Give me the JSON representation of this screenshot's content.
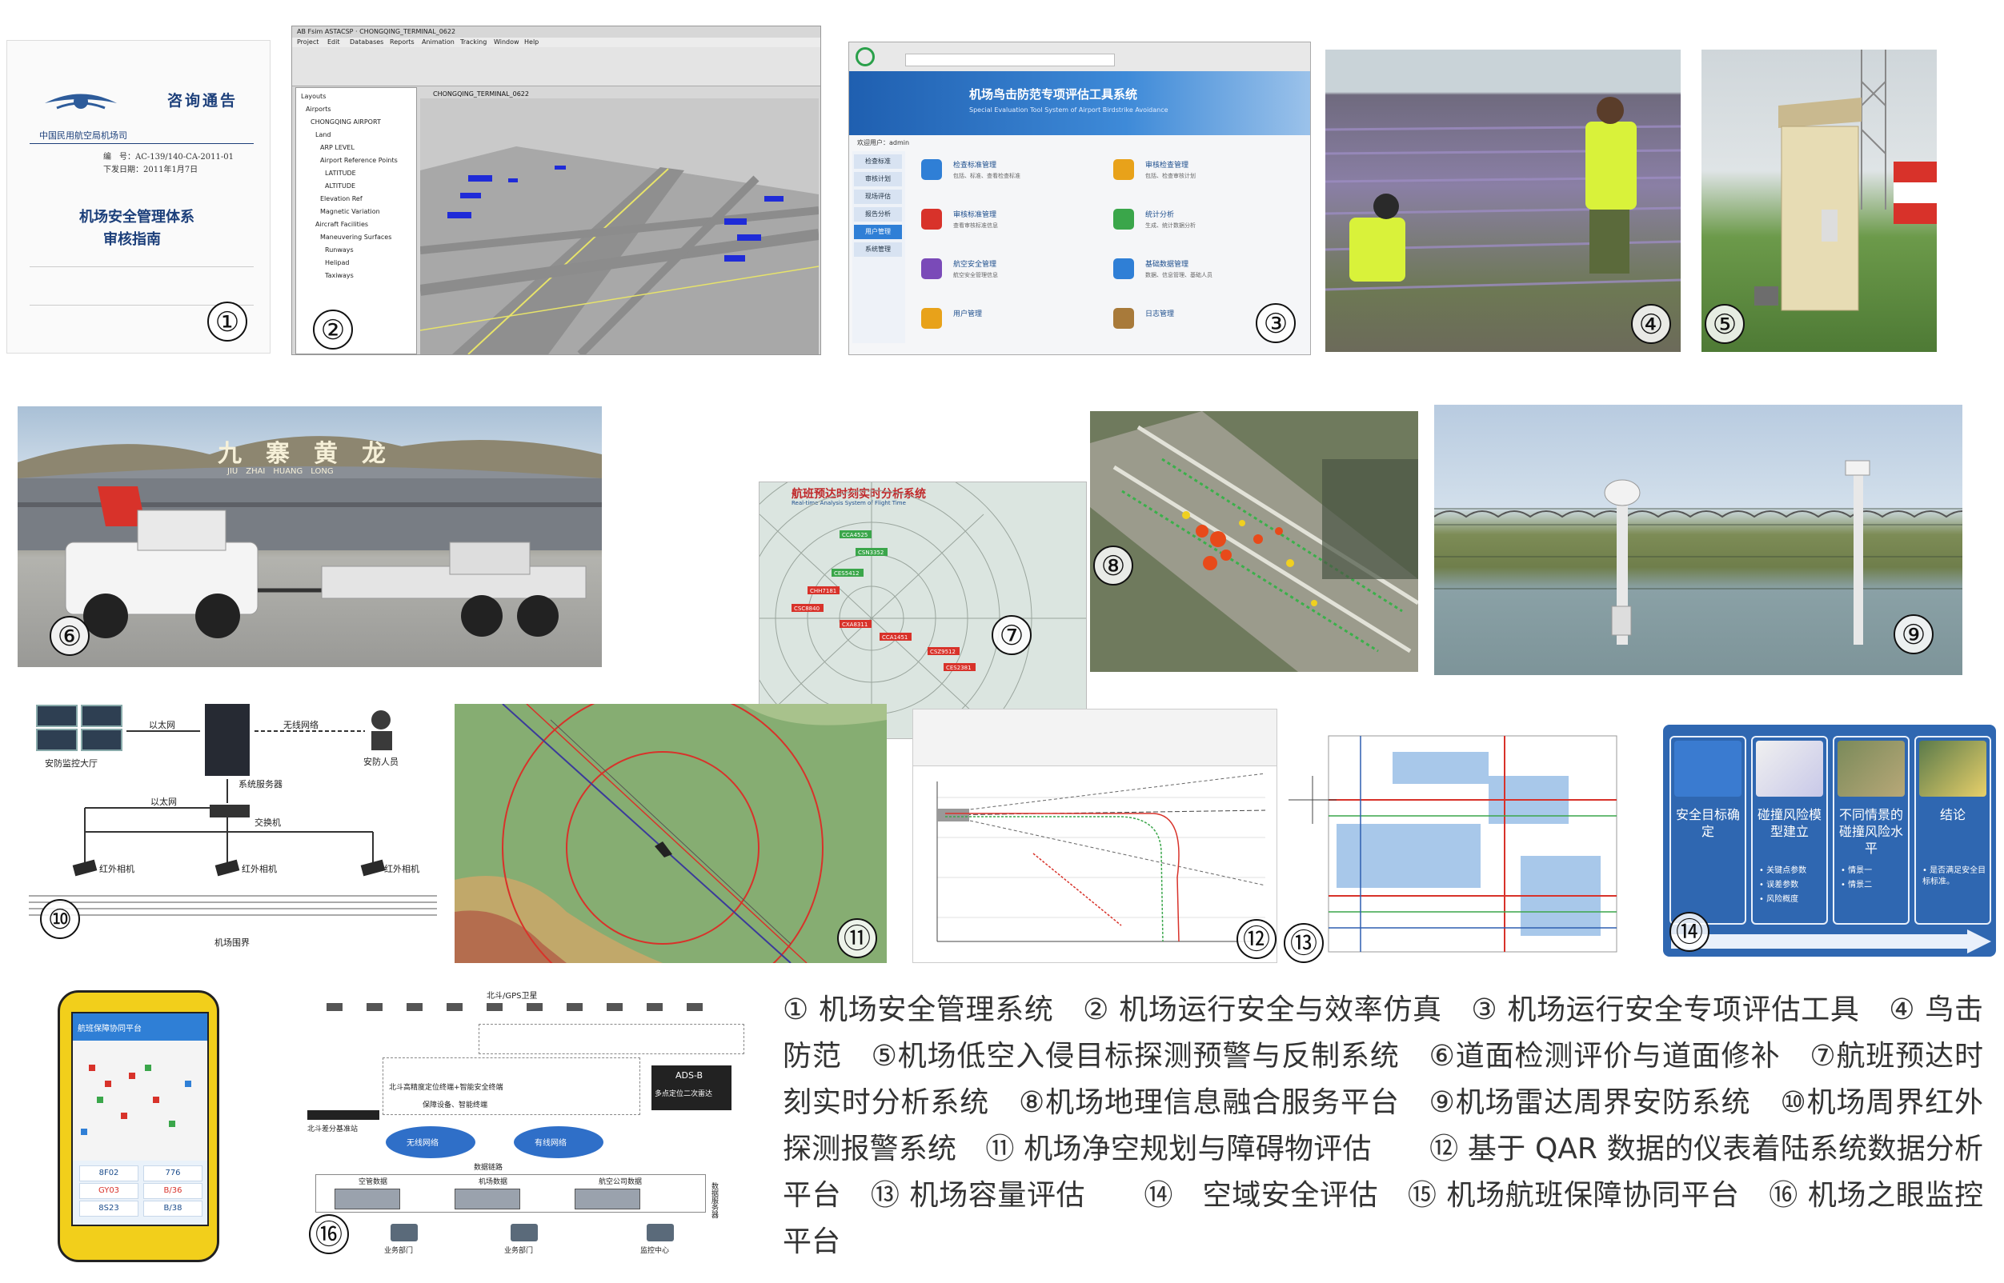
{
  "panels": {
    "p1": {
      "number": "①",
      "doc_header": "咨询通告",
      "issuer": "中国民用航空局机场司",
      "doc_no": "编　号：AC-139/140-CA-2011-01",
      "doc_date": "下发日期：2011年1月7日",
      "doc_title_1": "机场安全管理体系",
      "doc_title_2": "审核指南"
    },
    "p2": {
      "number": "②",
      "window_title": "AB Fsim ASTACSP · CHONGQING_TERMINAL_0622",
      "menu": [
        "Project",
        "Edit",
        "Databases",
        "Reports",
        "Animation",
        "Tracking",
        "Window",
        "Help"
      ],
      "tree": [
        "Layouts",
        "Airports",
        "CHONGQING AIRPORT",
        "Land",
        "ARP LEVEL",
        "Airport Reference Points",
        "LATITUDE",
        "ALTITUDE",
        "Elevation Ref",
        "Magnetic Variation",
        "Aircraft Facilities",
        "Maneuvering Surfaces",
        "Runways",
        "Helipad",
        "Taxiways"
      ],
      "view_label": "CHONGQING_TERMINAL_0622"
    },
    "p3": {
      "number": "③",
      "system_title": "机场鸟击防范专项评估工具系统",
      "system_subtitle": "Special Evaluation Tool System of Airport Birdstrike Avoidance",
      "user_label": "欢迎用户：admin",
      "sidebar": [
        "检查标准",
        "审核计划",
        "现场评估",
        "报告分析",
        "用户管理",
        "系统管理"
      ],
      "tiles": [
        {
          "title": "检查标准管理",
          "desc": "包括、标准、查看检查标准"
        },
        {
          "title": "审核检查管理",
          "desc": "包括、检查审核计划"
        },
        {
          "title": "审核标准管理",
          "desc": "查看审核标准信息"
        },
        {
          "title": "统计分析",
          "desc": "生成、统计数据分析"
        },
        {
          "title": "航空安全管理",
          "desc": "航空安全管理信息"
        },
        {
          "title": "基础数据管理",
          "desc": "数据、信息管理、基础人员"
        },
        {
          "title": "用户管理",
          "desc": ""
        },
        {
          "title": "日志管理",
          "desc": ""
        }
      ]
    },
    "p4": {
      "number": "④"
    },
    "p5": {
      "number": "⑤"
    },
    "p6": {
      "number": "⑥",
      "terminal_sign": "九　寨　黄　龙",
      "terminal_sign_en": "JIU　ZHAI　HUANG　LONG"
    },
    "p7": {
      "number": "⑦",
      "title": "航班预达时刻实时分析系统",
      "subtitle": "Real-time Analysis System of Flight Time",
      "flights": [
        "CCA4525",
        "CSN3352",
        "CES5412",
        "CHH7181",
        "CSC8840",
        "CXA8311",
        "CCA1451",
        "CSZ9512",
        "CES2381"
      ]
    },
    "p8": {
      "number": "⑧"
    },
    "p9": {
      "number": "⑨"
    },
    "p10": {
      "number": "⑩",
      "hall": "安防监控大厅",
      "ethernet_1": "以太网",
      "wireless": "无线网络",
      "server": "系统服务器",
      "guard": "安防人员",
      "ethernet_2": "以太网",
      "switch": "交换机",
      "camera": "红外相机",
      "fence": "机场围界"
    },
    "p11": {
      "number": "⑪"
    },
    "p12": {
      "number": "⑫"
    },
    "p13": {
      "number": "⑬"
    },
    "p14": {
      "number": "⑭",
      "steps": [
        {
          "title": "安全目标确定",
          "notes": []
        },
        {
          "title": "碰撞风险模型建立",
          "notes": [
            "关键点参数",
            "误差参数",
            "风险概度"
          ]
        },
        {
          "title": "不同情景的碰撞风险水平",
          "notes": [
            "情景一",
            "情景二"
          ]
        },
        {
          "title": "结论",
          "notes": [
            "是否满足安全目标标准。"
          ]
        }
      ]
    },
    "p15": {
      "number": "⑮",
      "app_header": "航班保障协同平台",
      "stats": [
        "8F02",
        "776",
        "GY03",
        "B/36",
        "8S23",
        "B/38"
      ]
    },
    "p16": {
      "number": "⑯",
      "satellite": "北斗/GPS卫星",
      "ads_b": "ADS-B",
      "ads_b_sub": "多点定位二次雷达",
      "receiver": "北斗差分基准站",
      "vehicles": "北斗高精度定位终端+智能安全终端",
      "vehicle_note": "保障设备、智能终端",
      "wireless_net": "无线网络",
      "wired_net": "有线网络",
      "data_link": "数据链路",
      "servers": [
        "空管数据",
        "机场数据",
        "航空公司数据"
      ],
      "side_label": "数据服务器",
      "users": [
        "业务部门",
        "业务部门",
        "监控中心"
      ]
    }
  },
  "caption": "① 机场安全管理系统　② 机场运行安全与效率仿真　③ 机场运行安全专项评估工具　④ 鸟击防范　⑤机场低空入侵目标探测预警与反制系统　⑥道面检测评价与道面修补　⑦航班预达时刻实时分析系统　⑧机场地理信息融合服务平台　⑨机场雷达周界安防系统　⑩机场周界红外探测报警系统　⑪ 机场净空规划与障碍物评估　　⑫ 基于 QAR 数据的仪表着陆系统数据分析平台　⑬ 机场容量评估　　⑭　空域安全评估　⑮ 机场航班保障协同平台　⑯ 机场之眼监控平台",
  "colors": {
    "flow_blue": "#2f67b1",
    "phone_yellow": "#f2cf1b",
    "alert_red": "#d8322a",
    "green_marker": "#3aa64a"
  }
}
